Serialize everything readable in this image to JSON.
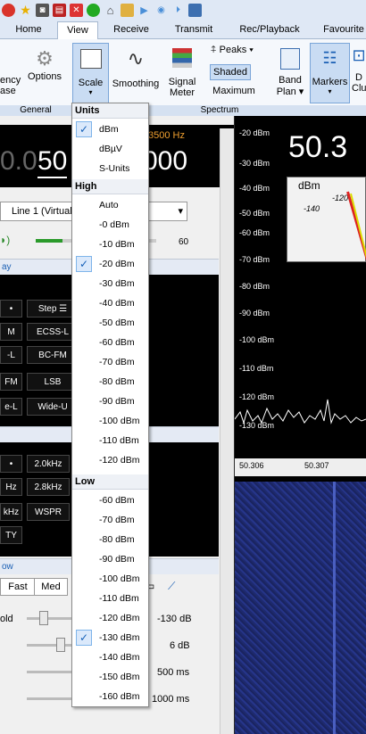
{
  "quick_access": [
    "red-record-icon",
    "star-icon",
    "camera-icon",
    "pdf-icon",
    "close-x-icon",
    "green-circle-icon",
    "home-icon",
    "folder-icon",
    "play-icon",
    "play-icon",
    "folder-icon"
  ],
  "tabs": [
    "Home",
    "View",
    "Receive",
    "Transmit",
    "Rec/Playback",
    "Favourite"
  ],
  "ribbon": {
    "frequency_label": "ency",
    "phase_label": "ase",
    "options": "Options",
    "scale": "Scale",
    "smoothing": "Smoothing",
    "signal": "Signal",
    "meter": "Meter",
    "peaks": "Peaks",
    "shaded": "Shaded",
    "maximum": "Maximum",
    "band": "Band",
    "plan": "Plan",
    "markers": "Markers",
    "d": "D",
    "clu": "Clu",
    "general": "General",
    "spectrum": "Spectrum"
  },
  "left": {
    "freq_small": "3500 Hz",
    "freq_big_a": "0.0",
    "freq_big_b": "50",
    "freq_big_c": "000",
    "line_input": "Line 1 (Virtual",
    "volume_value": "60",
    "section_1": "ay",
    "step": "Step ☰",
    "modes": [
      [
        "M",
        "ECSS-L"
      ],
      [
        "-L",
        "BC-FM"
      ],
      [
        "FM",
        "LSB"
      ],
      [
        "e-L",
        "Wide-U"
      ]
    ],
    "filters": [
      [
        "",
        "2.0kHz"
      ],
      [
        "Hz",
        "2.8kHz"
      ],
      [
        "kHz",
        "WSPR"
      ],
      [
        "TY",
        ""
      ]
    ],
    "section_2": "ow",
    "agc_fast": "Fast",
    "agc_med": "Med",
    "agc_label": "old",
    "agc_values": [
      "-130 dB",
      "6 dB",
      "500 ms",
      "1000 ms"
    ]
  },
  "spectrum": {
    "big_freq": "50.3",
    "meter_unit": "dBm",
    "meter_ticks": [
      "-140",
      "-120"
    ],
    "db_labels": [
      "-20 dBm",
      "-30 dBm",
      "-40 dBm",
      "-50 dBm",
      "-60 dBm",
      "-70 dBm",
      "-80 dBm",
      "-90 dBm",
      "-100 dBm",
      "-110 dBm",
      "-120 dBm",
      "-130 dBm"
    ],
    "x_labels": [
      "50.306",
      "50.307"
    ]
  },
  "menu": {
    "units_header": "Units",
    "units": [
      "dBm",
      "dBµV",
      "S-Units"
    ],
    "units_checked": 0,
    "high_header": "High",
    "high": [
      "Auto",
      "-0 dBm",
      "-10 dBm",
      "-20 dBm",
      "-30 dBm",
      "-40 dBm",
      "-50 dBm",
      "-60 dBm",
      "-70 dBm",
      "-80 dBm",
      "-90 dBm",
      "-100 dBm",
      "-110 dBm",
      "-120 dBm"
    ],
    "high_checked": 3,
    "low_header": "Low",
    "low": [
      "-60 dBm",
      "-70 dBm",
      "-80 dBm",
      "-90 dBm",
      "-100 dBm",
      "-110 dBm",
      "-120 dBm",
      "-130 dBm",
      "-140 dBm",
      "-150 dBm",
      "-160 dBm"
    ],
    "low_checked": 7
  }
}
